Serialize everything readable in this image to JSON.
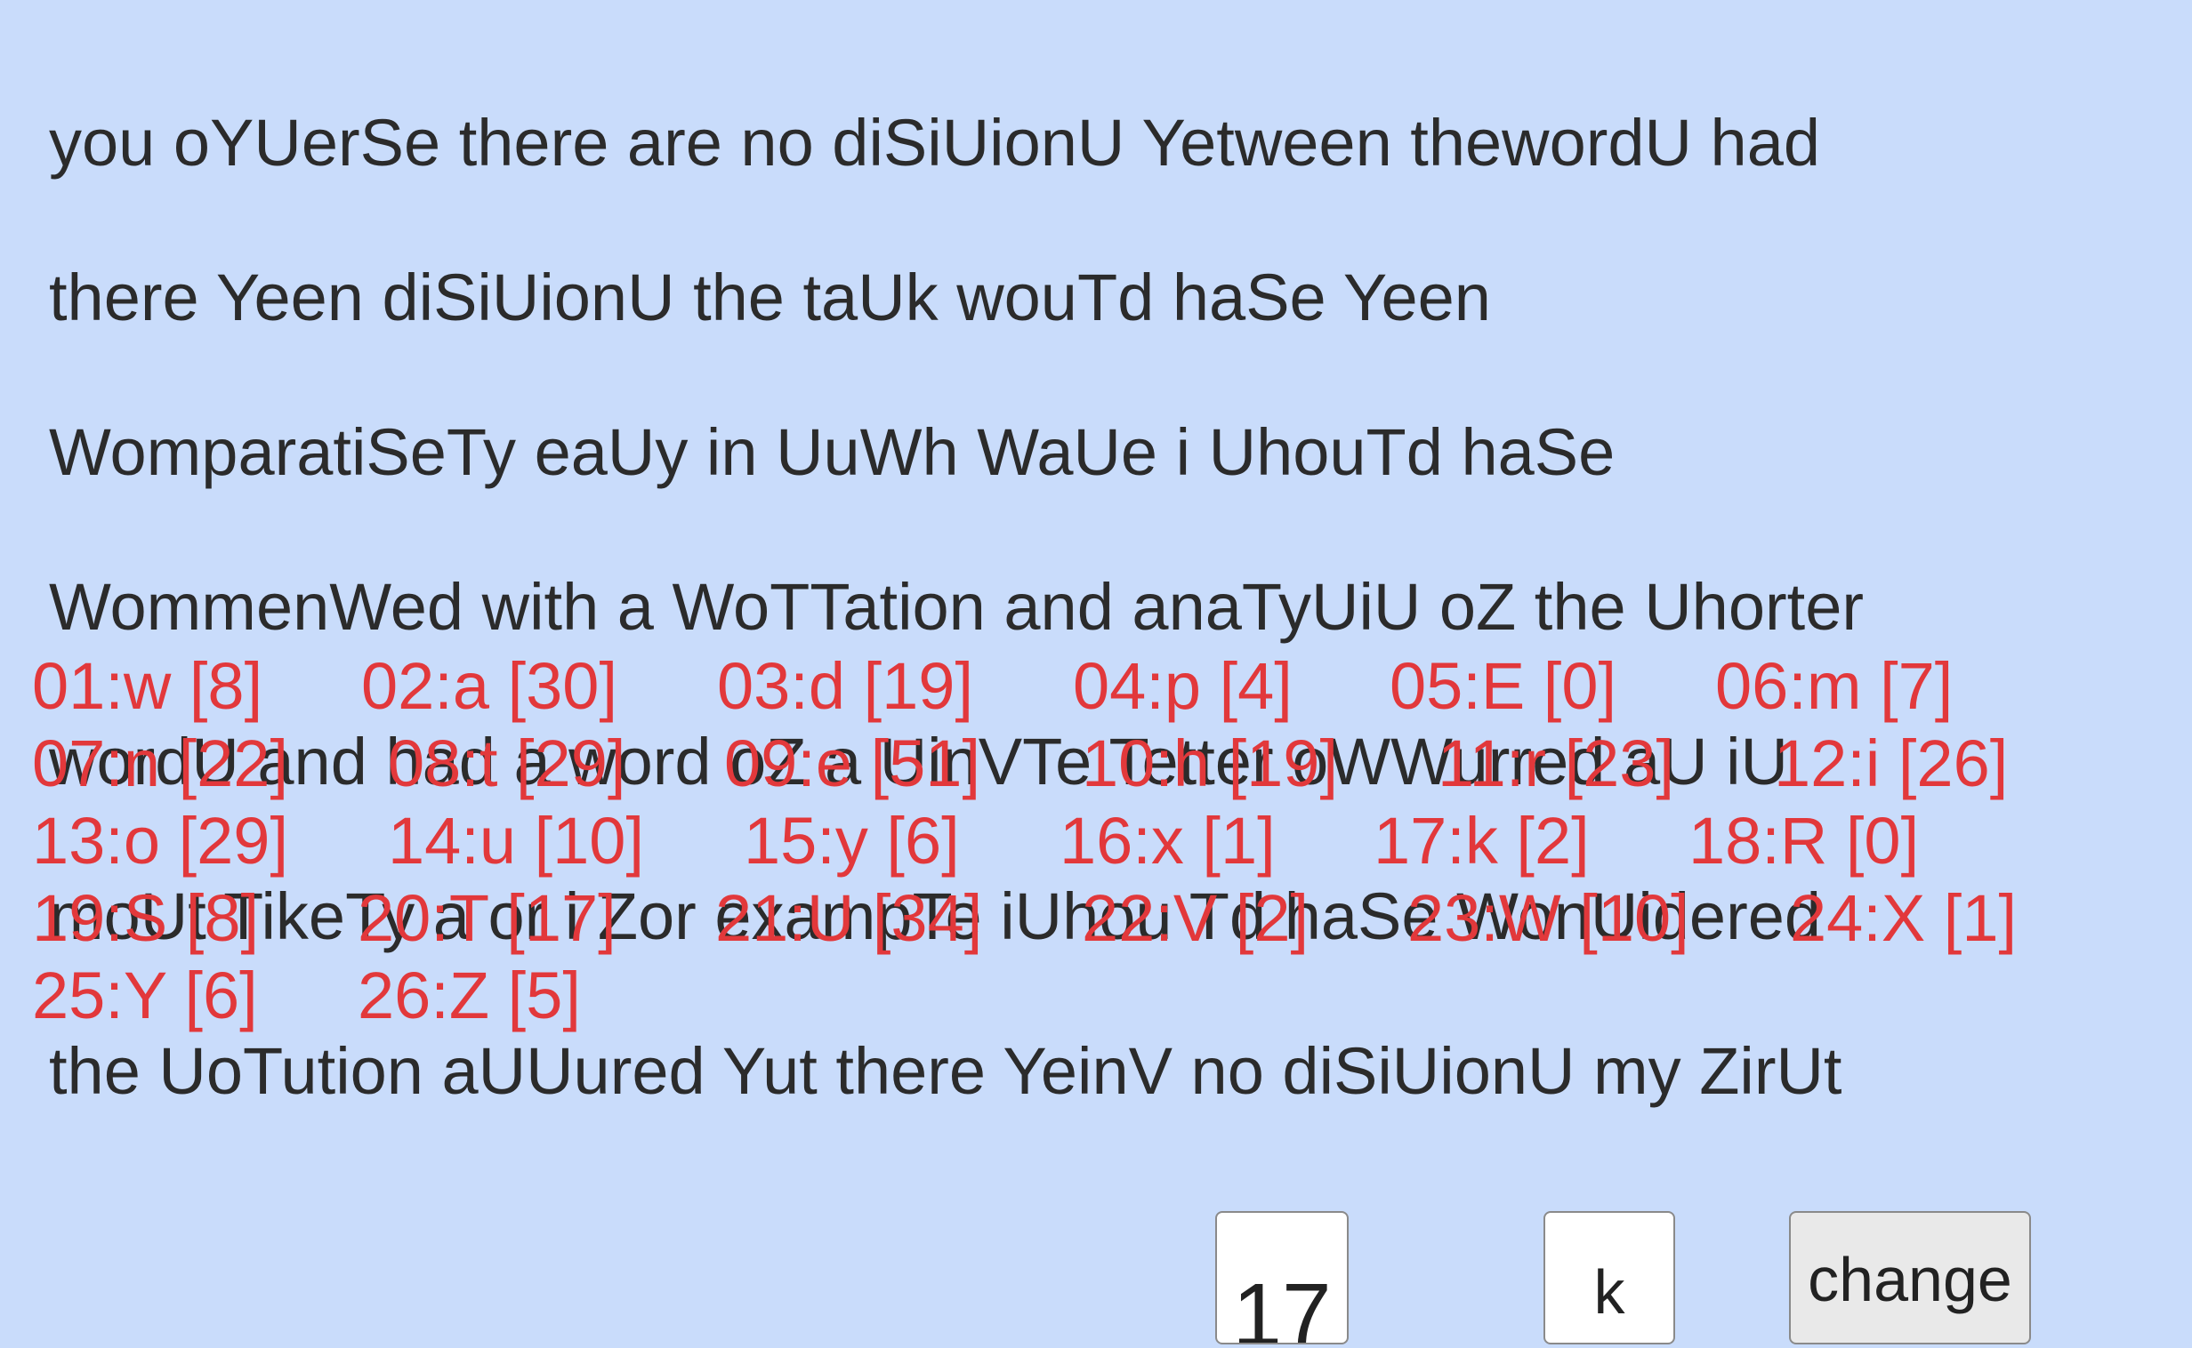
{
  "cipher_text": [
    "you oYUerSe there are no diSiUionU Yetween thewordU had",
    "there Yeen diSiUionU the taUk wouTd haSe Yeen",
    "WomparatiSeTy eaUy in UuWh WaUe i UhouTd haSe",
    "WommenWed with a WoTTation and anaTyUiU oZ the Uhorter",
    "wordU and had a word oZ a UinVTe Tetter oWWurred aU iU",
    "moUt TikeTy a or i Zor exampTe iUhou Td haSe WonUidered",
    "the UoTution aUUured Yut there YeinV no diSiUionU my ZirUt"
  ],
  "frequency_table": [
    [
      "01:w [8]",
      "02:a [30]",
      "03:d [19]",
      "04:p [4]",
      "05:E [0]",
      "06:m [7]"
    ],
    [
      "07:n [22]",
      "08:t [29]",
      "09:e [51]",
      "10:h [19]",
      "11:r [23]",
      "12:i [26]"
    ],
    [
      "13:o [29]",
      "14:u [10]",
      "15:y [6]",
      "16:x [1]",
      "17:k [2]",
      "18:R [0]"
    ],
    [
      "19:S [8]",
      "20:T [17]",
      "21:U [34]",
      "22:V [2]",
      "23:W [10]",
      "24:X [1]"
    ],
    [
      "25:Y [6]",
      "26:Z [5]"
    ]
  ],
  "controls": {
    "number_value": "17",
    "letter_value": "k",
    "change_label": "change"
  },
  "colors": {
    "background": "#c9dcfb",
    "text": "#2b2b2b",
    "frequency_text": "#e2383b"
  }
}
